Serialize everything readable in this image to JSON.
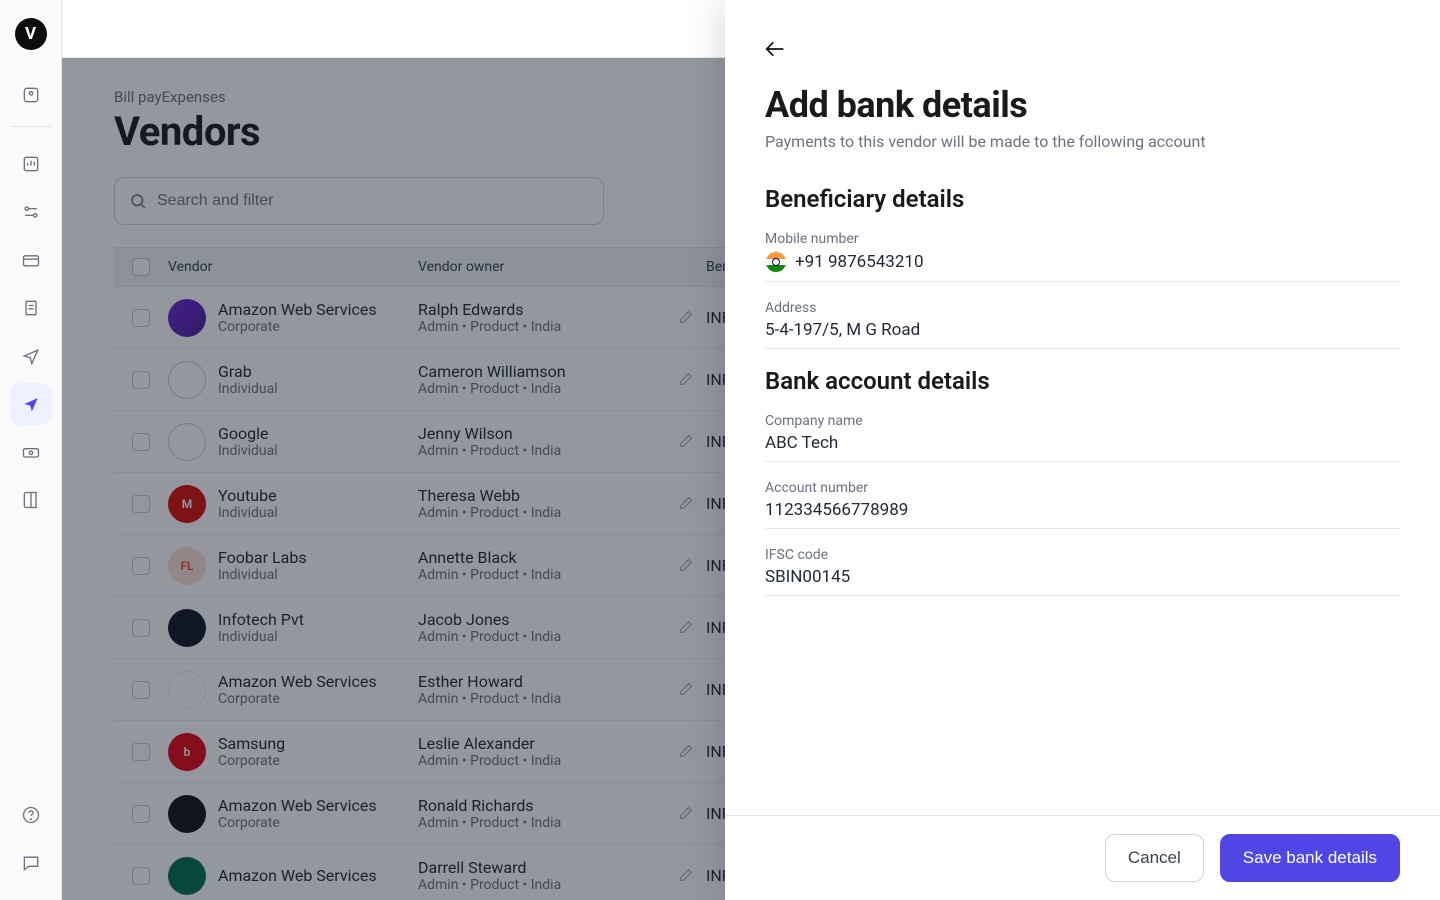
{
  "breadcrumb": "Bill payExpenses",
  "page_title": "Vendors",
  "search": {
    "placeholder": "Search and filter"
  },
  "columns": {
    "vendor": "Vendor",
    "owner": "Vendor owner",
    "beneficiary": "Beneficiary"
  },
  "owner_meta": "Admin • Product  •  India",
  "beneficiary_prefix": "INR",
  "rows": [
    {
      "vendor": "Amazon Web Services",
      "type": "Corporate",
      "owner": "Ralph Edwards",
      "avatar_class": "av-purple",
      "avatar_text": ""
    },
    {
      "vendor": "Grab",
      "type": "Individual",
      "owner": "Cameron Williamson",
      "avatar_class": "av-bmw",
      "avatar_text": ""
    },
    {
      "vendor": "Google",
      "type": "Individual",
      "owner": "Jenny Wilson",
      "avatar_class": "av-dom",
      "avatar_text": ""
    },
    {
      "vendor": "Youtube",
      "type": "Individual",
      "owner": "Theresa Webb",
      "avatar_class": "av-mcd",
      "avatar_text": "M"
    },
    {
      "vendor": "Foobar Labs",
      "type": "Individual",
      "owner": "Annette Black",
      "avatar_class": "av-fl",
      "avatar_text": "FL"
    },
    {
      "vendor": "Infotech Pvt",
      "type": "Individual",
      "owner": "Jacob Jones",
      "avatar_class": "av-dell",
      "avatar_text": ""
    },
    {
      "vendor": "Amazon Web Services",
      "type": "Corporate",
      "owner": "Esther Howard",
      "avatar_class": "av-hua",
      "avatar_text": ""
    },
    {
      "vendor": "Samsung",
      "type": "Corporate",
      "owner": "Leslie Alexander",
      "avatar_class": "av-beats",
      "avatar_text": "b"
    },
    {
      "vendor": "Amazon Web Services",
      "type": "Corporate",
      "owner": "Ronald Richards",
      "avatar_class": "av-gopro",
      "avatar_text": ""
    },
    {
      "vendor": "Amazon Web Services",
      "type": "",
      "owner": "Darrell Steward",
      "avatar_class": "av-star",
      "avatar_text": ""
    }
  ],
  "panel": {
    "title": "Add bank details",
    "subtitle": "Payments to this vendor will be made to the following account",
    "section_beneficiary": "Beneficiary details",
    "section_bank": "Bank account details",
    "fields": {
      "mobile_label": "Mobile number",
      "mobile_value": "+91 9876543210",
      "address_label": "Address",
      "address_value": "5-4-197/5, M G Road",
      "company_label": "Company name",
      "company_value": "ABC Tech",
      "account_label": "Account number",
      "account_value": "112334566778989",
      "ifsc_label": "IFSC code",
      "ifsc_value": "SBIN00145"
    },
    "cancel": "Cancel",
    "save": "Save bank details"
  }
}
